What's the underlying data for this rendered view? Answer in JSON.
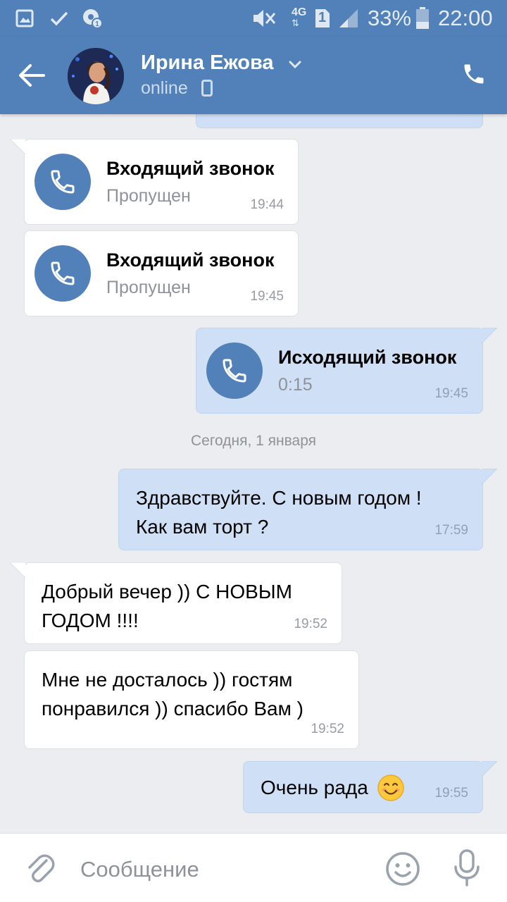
{
  "status_bar": {
    "battery_percent": "33%",
    "clock": "22:00",
    "network_label": "4G",
    "sim_label": "1"
  },
  "header": {
    "contact_name": "Ирина Ежова",
    "contact_status": "online"
  },
  "messages": [
    {
      "type": "call",
      "direction": "in",
      "title": "Входящий звонок",
      "subtitle": "Пропущен",
      "time": "19:44"
    },
    {
      "type": "call",
      "direction": "in",
      "title": "Входящий звонок",
      "subtitle": "Пропущен",
      "time": "19:45"
    },
    {
      "type": "call",
      "direction": "out",
      "title": "Исходящий звонок",
      "subtitle": "0:15",
      "time": "19:45"
    },
    {
      "type": "text",
      "direction": "out",
      "lines": [
        "Здравствуйте. С новым годом !",
        "Как вам торт ?"
      ],
      "time": "17:59"
    },
    {
      "type": "text",
      "direction": "in",
      "lines": [
        "Добрый вечер )) С НОВЫМ",
        "ГОДОМ !!!!"
      ],
      "time": "19:52"
    },
    {
      "type": "text",
      "direction": "in",
      "lines": [
        "Мне не досталось )) гостям",
        "понравился )) спасибо Вам )"
      ],
      "time": "19:52"
    },
    {
      "type": "text",
      "direction": "out",
      "lines": [
        "Очень рада"
      ],
      "emoji": "smiling-face",
      "time": "19:55"
    }
  ],
  "date_separator": "Сегодня, 1 января",
  "input": {
    "placeholder": "Сообщение"
  },
  "colors": {
    "brand": "#5181b8",
    "outgoing_bubble": "#cfe0f6",
    "incoming_bubble": "#ffffff",
    "background": "#ebedf0"
  },
  "icons": [
    "gallery-icon",
    "check-icon",
    "settings-badge-icon",
    "mute-icon",
    "signal-icon",
    "battery-icon",
    "back-arrow-icon",
    "chevron-down-icon",
    "mobile-icon",
    "phone-icon",
    "paperclip-icon",
    "emoji-icon",
    "microphone-icon"
  ]
}
